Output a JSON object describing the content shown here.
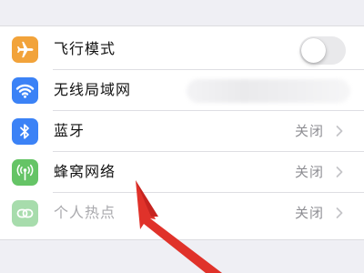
{
  "settings": {
    "rows": [
      {
        "label": "飞行模式",
        "icon": "airplane-icon",
        "color": "#f2a33a",
        "accessory": "toggle",
        "toggle_on": false
      },
      {
        "label": "无线局域网",
        "icon": "wifi-icon",
        "color": "#3b82f6",
        "accessory": "blurred-value"
      },
      {
        "label": "蓝牙",
        "icon": "bluetooth-icon",
        "color": "#3b82f6",
        "value": "关闭",
        "accessory": "chevron"
      },
      {
        "label": "蜂窝网络",
        "icon": "cellular-icon",
        "color": "#65c466",
        "value": "关闭",
        "accessory": "chevron"
      },
      {
        "label": "个人热点",
        "icon": "hotspot-icon",
        "color": "#a7dcac",
        "value": "关闭",
        "accessory": "chevron",
        "disabled": true
      }
    ]
  },
  "annotation": {
    "type": "red-arrow",
    "points_to": "蜂窝网络",
    "color": "#e0322a"
  }
}
